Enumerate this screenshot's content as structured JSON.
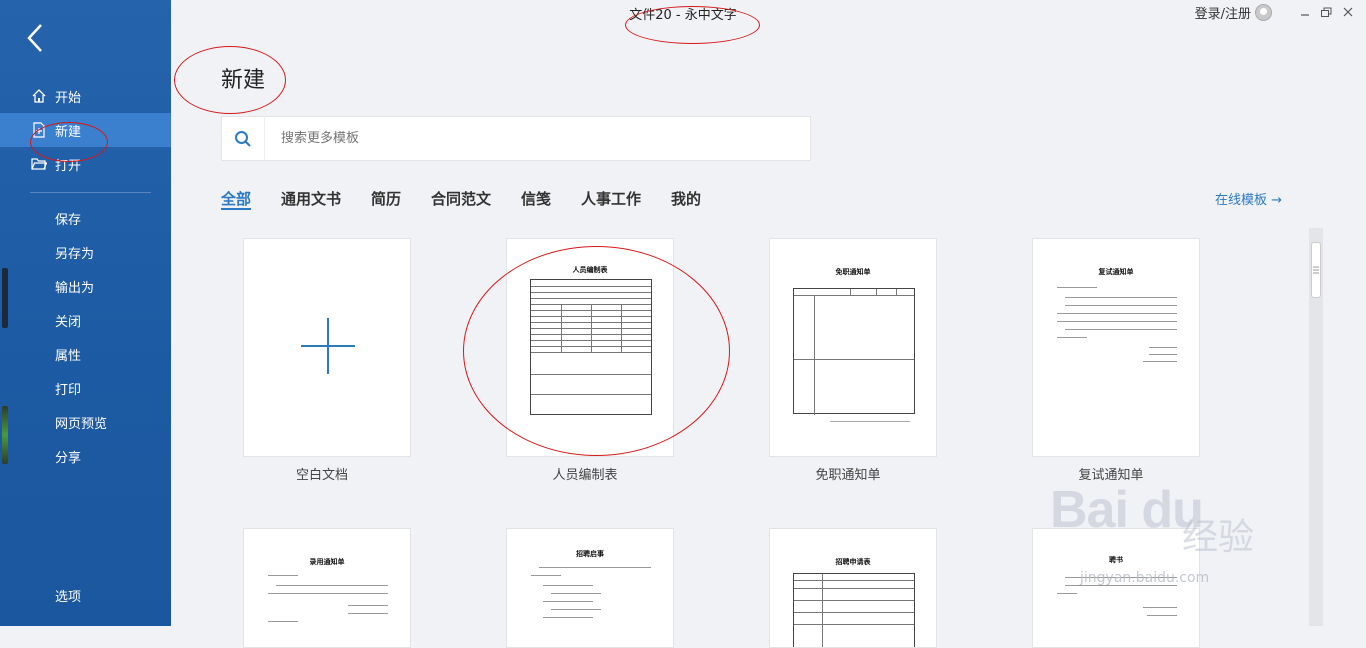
{
  "window": {
    "title": "文件20 - 永中文字",
    "login": "登录/注册"
  },
  "sidebar": {
    "main_items": [
      {
        "label": "开始",
        "icon": "home-icon"
      },
      {
        "label": "新建",
        "icon": "new-doc-icon",
        "active": true
      },
      {
        "label": "打开",
        "icon": "folder-icon"
      }
    ],
    "sub_items": [
      "保存",
      "另存为",
      "输出为",
      "关闭",
      "属性",
      "打印",
      "网页预览",
      "分享"
    ],
    "bottom_items": [
      "选项"
    ]
  },
  "main": {
    "title": "新建",
    "search_placeholder": "搜索更多模板",
    "tabs": [
      "全部",
      "通用文书",
      "简历",
      "合同范文",
      "信笺",
      "人事工作",
      "我的"
    ],
    "active_tab": 0,
    "online_link": "在线模板 →",
    "templates": [
      {
        "label": "空白文档",
        "doc_title": ""
      },
      {
        "label": "人员编制表",
        "doc_title": "人员编制表"
      },
      {
        "label": "免职通知单",
        "doc_title": "免职通知单"
      },
      {
        "label": "复试通知单",
        "doc_title": "复试通知单"
      },
      {
        "label": "",
        "doc_title": "录用通知单"
      },
      {
        "label": "",
        "doc_title": "招聘启事"
      },
      {
        "label": "",
        "doc_title": "招聘申请表"
      },
      {
        "label": "",
        "doc_title": "聘书"
      }
    ]
  },
  "watermark": {
    "brand": "Bai du",
    "cn": "经验",
    "url": "jingyan.baidu.com"
  },
  "colors": {
    "sidebar": "#1f5fa8",
    "accent": "#2b79c2",
    "annotation": "#d51919"
  }
}
